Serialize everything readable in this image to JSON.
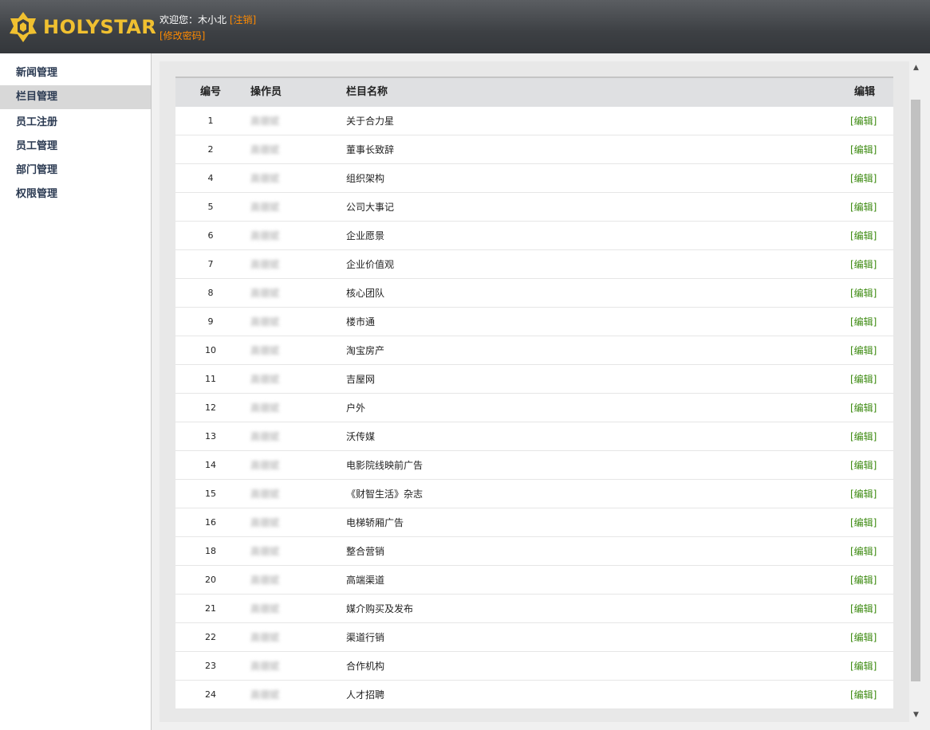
{
  "header": {
    "logo_text": "HOLYSTAR",
    "welcome": "欢迎您：",
    "username": "木小北",
    "logout": "[注销]",
    "change_password": "[修改密码]"
  },
  "sidebar": {
    "items": [
      {
        "label": "新闻管理",
        "active": false
      },
      {
        "label": "栏目管理",
        "active": true
      },
      {
        "label": "员工注册",
        "active": false
      },
      {
        "label": "员工管理",
        "active": false
      },
      {
        "label": "部门管理",
        "active": false
      },
      {
        "label": "权限管理",
        "active": false
      }
    ]
  },
  "table": {
    "headers": [
      "编号",
      "操作员",
      "栏目名称",
      "编辑"
    ],
    "operator_placeholder": "高德斌",
    "edit_label": "[编辑]",
    "rows": [
      {
        "id": "1",
        "name": "关于合力星"
      },
      {
        "id": "2",
        "name": "董事长致辞"
      },
      {
        "id": "4",
        "name": "组织架构"
      },
      {
        "id": "5",
        "name": "公司大事记"
      },
      {
        "id": "6",
        "name": "企业愿景"
      },
      {
        "id": "7",
        "name": "企业价值观"
      },
      {
        "id": "8",
        "name": "核心团队"
      },
      {
        "id": "9",
        "name": "楼市通"
      },
      {
        "id": "10",
        "name": "淘宝房产"
      },
      {
        "id": "11",
        "name": "吉屋网"
      },
      {
        "id": "12",
        "name": "户外"
      },
      {
        "id": "13",
        "name": "沃传媒"
      },
      {
        "id": "14",
        "name": "电影院线映前广告"
      },
      {
        "id": "15",
        "name": "《财智生活》杂志"
      },
      {
        "id": "16",
        "name": "电梯轿厢广告"
      },
      {
        "id": "18",
        "name": "整合营销"
      },
      {
        "id": "20",
        "name": "高端渠道"
      },
      {
        "id": "21",
        "name": "媒介购买及发布"
      },
      {
        "id": "22",
        "name": "渠道行销"
      },
      {
        "id": "23",
        "name": "合作机构"
      },
      {
        "id": "24",
        "name": "人才招聘"
      }
    ]
  },
  "colors": {
    "header_bg": "#3d4044",
    "logo": "#f0c030",
    "link_orange": "#ff8a00",
    "edit_green": "#3c8a10",
    "nav_text": "#2b3a52",
    "nav_active_bg": "#d8d8d8"
  },
  "icons": {
    "logo": "star-logo-icon",
    "scroll_up": "scroll-up-arrow-icon",
    "scroll_down": "scroll-down-arrow-icon"
  }
}
